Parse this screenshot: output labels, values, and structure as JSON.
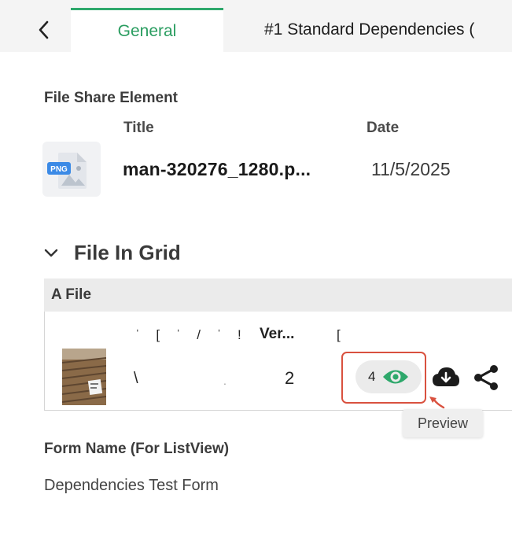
{
  "tabs": {
    "general": "General",
    "dependencies": "#1 Standard Dependencies ("
  },
  "file_share": {
    "section_label": "File Share Element",
    "col_title": "Title",
    "col_date": "Date",
    "file_icon_label": "PNG",
    "file_title": "man-320276_1280.p...",
    "file_date": "11/5/2025"
  },
  "grid": {
    "heading": "File In Grid",
    "column_bar": "A File",
    "cut_header": "ˈ [ ˈ / ˈ !",
    "cut_header_tail": "[",
    "cut_cell": "\\",
    "cut_cell_dot": ".",
    "version_header": "Ver...",
    "version_value": "2",
    "preview_count": "4",
    "tooltip": "Preview"
  },
  "form": {
    "label": "Form Name (For ListView)",
    "value": "Dependencies Test Form"
  },
  "colors": {
    "accent_green": "#2ea86b",
    "highlight_red": "#d9513f"
  },
  "icons": [
    "back-chevron-icon",
    "png-file-icon",
    "chevron-down-icon",
    "eye-icon",
    "cloud-download-icon",
    "share-icon"
  ]
}
